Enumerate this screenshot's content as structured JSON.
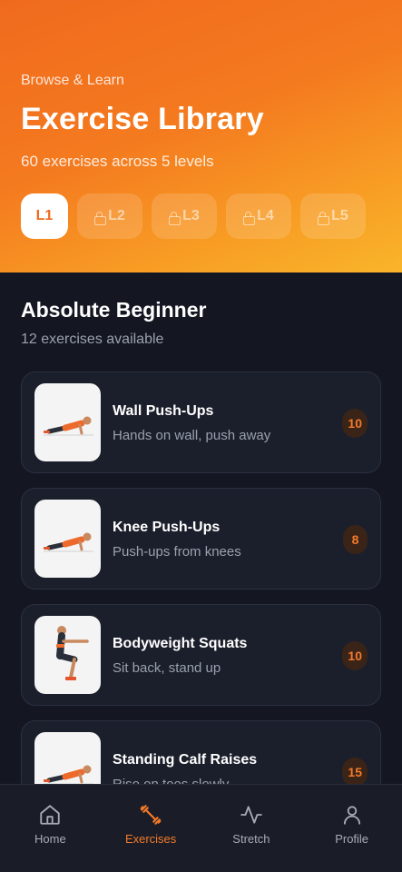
{
  "header": {
    "eyebrow": "Browse & Learn",
    "title": "Exercise Library",
    "subtitle": "60 exercises across 5 levels",
    "levels": [
      {
        "label": "L1",
        "locked": false,
        "active": true
      },
      {
        "label": "L2",
        "locked": true,
        "active": false
      },
      {
        "label": "L3",
        "locked": true,
        "active": false
      },
      {
        "label": "L4",
        "locked": true,
        "active": false
      },
      {
        "label": "L5",
        "locked": true,
        "active": false
      }
    ]
  },
  "section": {
    "title": "Absolute Beginner",
    "subtitle": "12 exercises available"
  },
  "exercises": [
    {
      "name": "Wall Push-Ups",
      "description": "Hands on wall, push away",
      "reps": "10",
      "icon": "pushup-figure"
    },
    {
      "name": "Knee Push-Ups",
      "description": "Push-ups from knees",
      "reps": "8",
      "icon": "pushup-figure"
    },
    {
      "name": "Bodyweight Squats",
      "description": "Sit back, stand up",
      "reps": "10",
      "icon": "squat-figure"
    },
    {
      "name": "Standing Calf Raises",
      "description": "Rise on toes slowly",
      "reps": "15",
      "icon": "pushup-figure"
    }
  ],
  "tabbar": {
    "items": [
      {
        "label": "Home",
        "icon": "home-icon"
      },
      {
        "label": "Exercises",
        "icon": "dumbbell-icon"
      },
      {
        "label": "Stretch",
        "icon": "activity-icon"
      },
      {
        "label": "Profile",
        "icon": "user-icon"
      }
    ],
    "active": "Exercises"
  },
  "colors": {
    "accent": "#f47a2a",
    "header_start": "#f06a1e",
    "header_end": "#f9b52a",
    "background": "#141722",
    "card": "#1b1f2b"
  }
}
